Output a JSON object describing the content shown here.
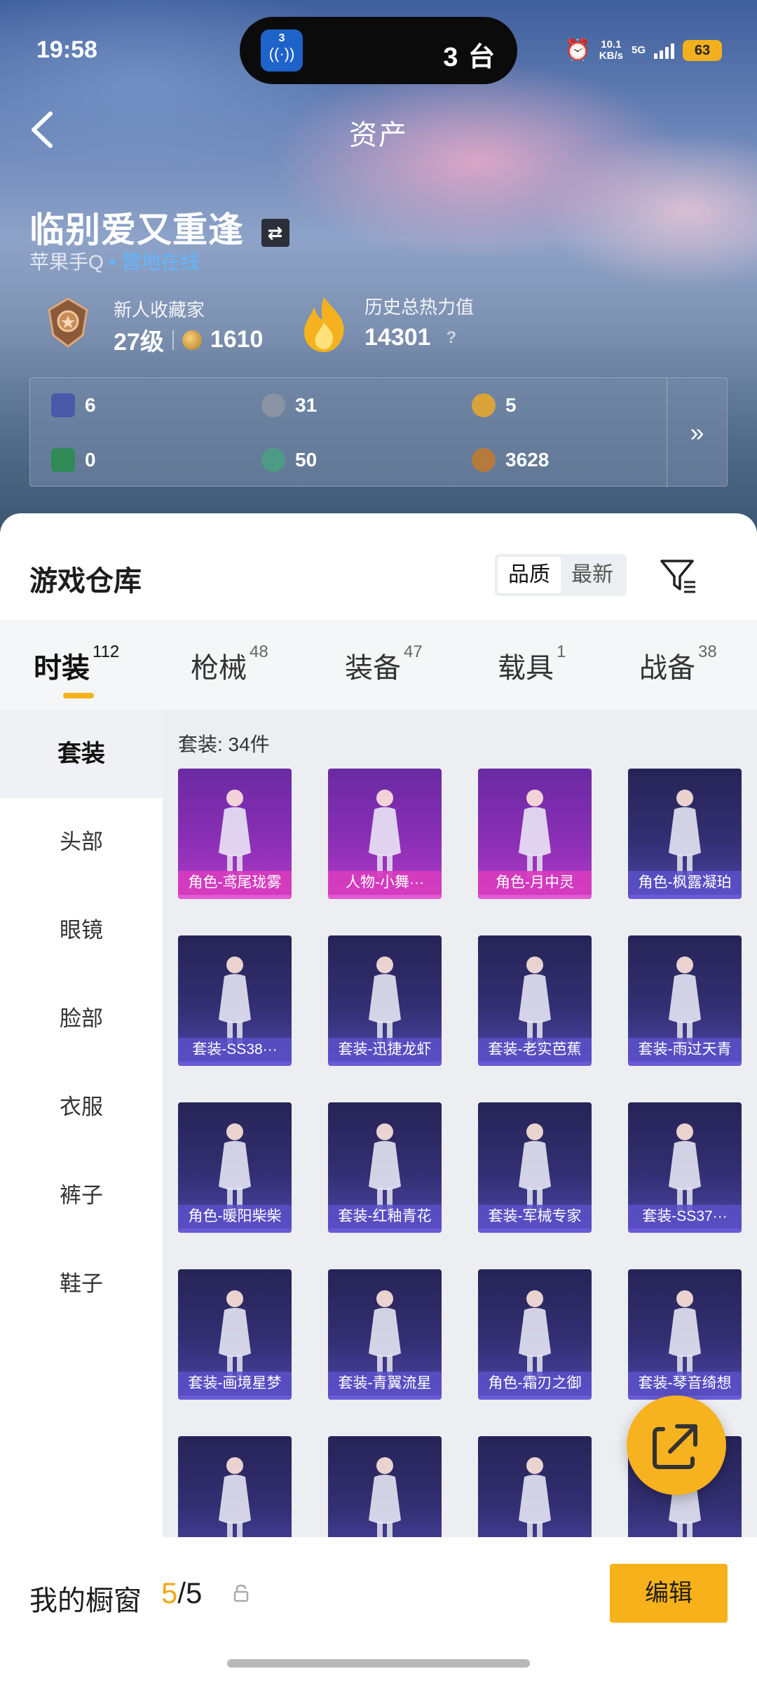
{
  "status_bar": {
    "time": "19:58",
    "island_app_number": "3",
    "island_text": "3 台",
    "net_speed": "10.1",
    "net_unit": "KB/s",
    "network": "5G",
    "battery": "63"
  },
  "header": {
    "title": "资产",
    "back_icon": "chevron-left-icon"
  },
  "profile": {
    "name": "临别爱又重逢",
    "platform": "苹果手Q",
    "online_status": "营地在线",
    "rank_title": "新人收藏家",
    "level": "27级",
    "points": "1610",
    "heat_title": "历史总热力值",
    "heat_value": "14301",
    "help": "?"
  },
  "stats": [
    {
      "icon": "card-icon",
      "value": "6",
      "color": "#4a5aa8"
    },
    {
      "icon": "silver-coin-icon",
      "value": "31",
      "color": "#8a93a3"
    },
    {
      "icon": "gold-token-icon",
      "value": "5",
      "color": "#d9a33a"
    },
    {
      "icon": "green-card-icon",
      "value": "0",
      "color": "#2f8a55"
    },
    {
      "icon": "green-orb-icon",
      "value": "50",
      "color": "#4f9a85"
    },
    {
      "icon": "bronze-coin-icon",
      "value": "3628",
      "color": "#b57a3c"
    }
  ],
  "stats_more": "»",
  "warehouse": {
    "title": "游戏仓库",
    "sort_options": [
      "品质",
      "最新"
    ],
    "sort_active": "品质"
  },
  "tabs": [
    {
      "label": "时装",
      "count": "112"
    },
    {
      "label": "枪械",
      "count": "48"
    },
    {
      "label": "装备",
      "count": "47"
    },
    {
      "label": "载具",
      "count": "1"
    },
    {
      "label": "战备",
      "count": "38"
    }
  ],
  "categories": [
    "套装",
    "头部",
    "眼镜",
    "脸部",
    "衣服",
    "裤子",
    "鞋子"
  ],
  "grid_caption": "套装: 34件",
  "items": [
    {
      "label": "角色-鸢尾珑雾",
      "rarity": "purple"
    },
    {
      "label": "人物-小舞···",
      "rarity": "purple"
    },
    {
      "label": "角色-月中灵",
      "rarity": "purple"
    },
    {
      "label": "角色-枫露凝珀",
      "rarity": "blue"
    },
    {
      "label": "套装-SS38···",
      "rarity": "blue"
    },
    {
      "label": "套装-迅捷龙虾",
      "rarity": "blue"
    },
    {
      "label": "套装-老实芭蕉",
      "rarity": "blue"
    },
    {
      "label": "套装-雨过天青",
      "rarity": "blue"
    },
    {
      "label": "角色-暖阳柴柴",
      "rarity": "blue"
    },
    {
      "label": "套装-红釉青花",
      "rarity": "blue"
    },
    {
      "label": "套装-军械专家",
      "rarity": "blue"
    },
    {
      "label": "套装-SS37···",
      "rarity": "blue"
    },
    {
      "label": "套装-画境星梦",
      "rarity": "blue"
    },
    {
      "label": "套装-青翼流星",
      "rarity": "blue"
    },
    {
      "label": "角色-霜刃之御",
      "rarity": "blue"
    },
    {
      "label": "套装-琴音绮想",
      "rarity": "blue"
    },
    {
      "label": "",
      "rarity": "blue"
    },
    {
      "label": "",
      "rarity": "blue"
    },
    {
      "label": "",
      "rarity": "blue"
    },
    {
      "label": "",
      "rarity": "blue"
    }
  ],
  "footer": {
    "showcase_label": "我的橱窗",
    "showcase_current": "5",
    "showcase_total": "/5",
    "edit_label": "编辑"
  },
  "colors": {
    "accent": "#f6b21f",
    "online": "#5fb7ff",
    "purple_card": "#8a2fb5",
    "blue_card": "#332f73"
  }
}
